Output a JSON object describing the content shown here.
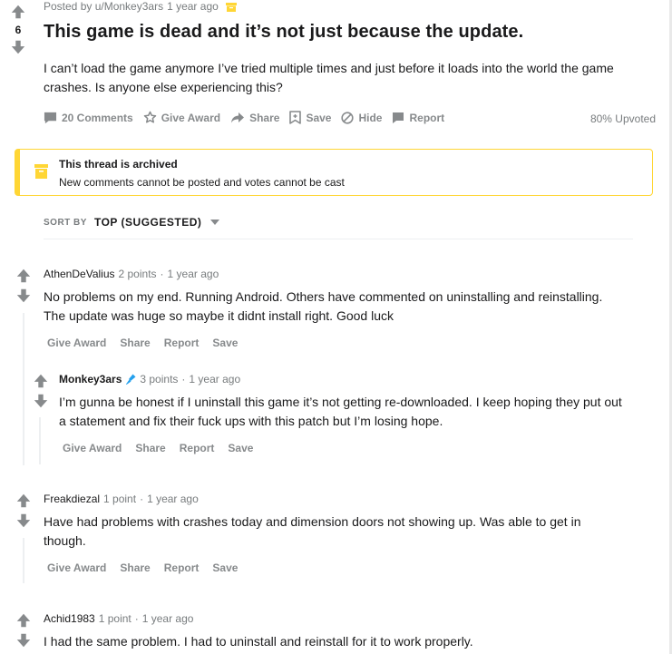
{
  "post": {
    "posted_by": "Posted by u/Monkey3ars",
    "time": "1 year ago",
    "score": "6",
    "title": "This game is dead and it’s not just because the update.",
    "body": "I can’t load the game anymore I’ve tried multiple times and just before it loads into the world the game crashes. Is anyone else experiencing this?",
    "actions": {
      "comments": "20 Comments",
      "give_award": "Give Award",
      "share": "Share",
      "save": "Save",
      "hide": "Hide",
      "report": "Report"
    },
    "upvoted": "80% Upvoted"
  },
  "banner": {
    "title": "This thread is archived",
    "text": "New comments cannot be posted and votes cannot be cast"
  },
  "sort": {
    "label": "SORT BY",
    "value": "TOP (SUGGESTED)"
  },
  "comments": [
    {
      "author": "AthenDeValius",
      "points": "2 points",
      "time": "1 year ago",
      "body": "No problems on my end. Running Android. Others have commented on uninstalling and reinstalling. The update was huge so maybe it didnt install right. Good luck",
      "actions": [
        "Give Award",
        "Share",
        "Report",
        "Save"
      ]
    },
    {
      "author": "Monkey3ars",
      "points": "3 points",
      "time": "1 year ago",
      "body": "I’m gunna be honest if I uninstall this game it’s not getting re-downloaded. I keep hoping they put out a statement and fix their fuck ups with this patch but I’m losing hope.",
      "actions": [
        "Give Award",
        "Share",
        "Report",
        "Save"
      ]
    },
    {
      "author": "Freakdiezal",
      "points": "1 point",
      "time": "1 year ago",
      "body": "Have had problems with crashes today and dimension doors not showing up. Was able to get in though.",
      "actions": [
        "Give Award",
        "Share",
        "Report",
        "Save"
      ]
    },
    {
      "author": "Achid1983",
      "points": "1 point",
      "time": "1 year ago",
      "body": "I had the same problem. I had to uninstall and reinstall for it to work properly."
    }
  ],
  "separator": "·",
  "colors": {
    "meta_gray": "#787c7e",
    "action_gray": "#878a8c",
    "arrow_gray": "#878a8c",
    "banner_yellow": "#ffd635",
    "mic_blue": "#24a0ed"
  },
  "icons": [
    "upvote-icon",
    "downvote-icon",
    "archive-icon",
    "comment-icon",
    "award-icon",
    "share-icon",
    "save-icon",
    "hide-icon",
    "report-icon",
    "microphone-icon",
    "chevron-down-icon"
  ]
}
